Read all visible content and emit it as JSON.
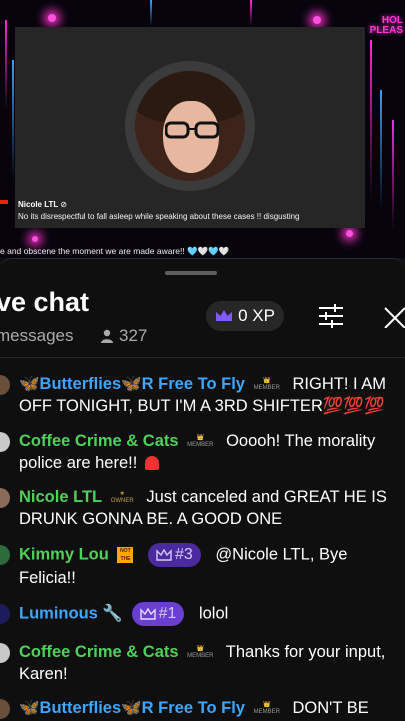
{
  "video": {
    "holiday_line1": "HOL",
    "holiday_line2": "PLEAS",
    "streamer_name": "Nicole LTL",
    "streamer_message": "No its disrespectful to fall asleep while speaking about these cases !! disgusting",
    "ticker": "e and obscene the moment we are made aware!! 🩵🤍🩵🤍"
  },
  "chat": {
    "title": "ve chat",
    "subtitle": "messages",
    "viewer_count": "327",
    "xp_label": "0 XP",
    "icons": {
      "crown": "crown-icon",
      "settings": "tune-icon",
      "close": "close-icon",
      "viewers": "person-icon"
    },
    "colors": {
      "member_name": "#4fd05a",
      "mod_name": "#3ea6ff",
      "badge_purple": "#4b2a9e"
    },
    "messages": [
      {
        "name": "🦋Butterflies🦋R Free To Fly",
        "text": "RIGHT! I AM OFF TONIGHT, BUT I'M A 3RD SHIFTER💯💯💯"
      },
      {
        "name": "Coffee Crime & Cats",
        "text": "Ooooh! The morality police are here!! "
      },
      {
        "name": "Nicole LTL",
        "text": "Just canceled and GREAT HE IS DRUNK GONNA BE. A GOOD ONE"
      },
      {
        "name": "Kimmy Lou",
        "badge": "#3",
        "text": "@Nicole LTL, Bye Felicia!!"
      },
      {
        "name": "Luminous",
        "badge": "#1",
        "text": "lolol"
      },
      {
        "name": "Coffee Crime & Cats",
        "text": "Thanks for your input, Karen!"
      },
      {
        "name": "🦋Butterflies🦋R Free To Fly",
        "text": "DON'T BE SO"
      }
    ]
  }
}
